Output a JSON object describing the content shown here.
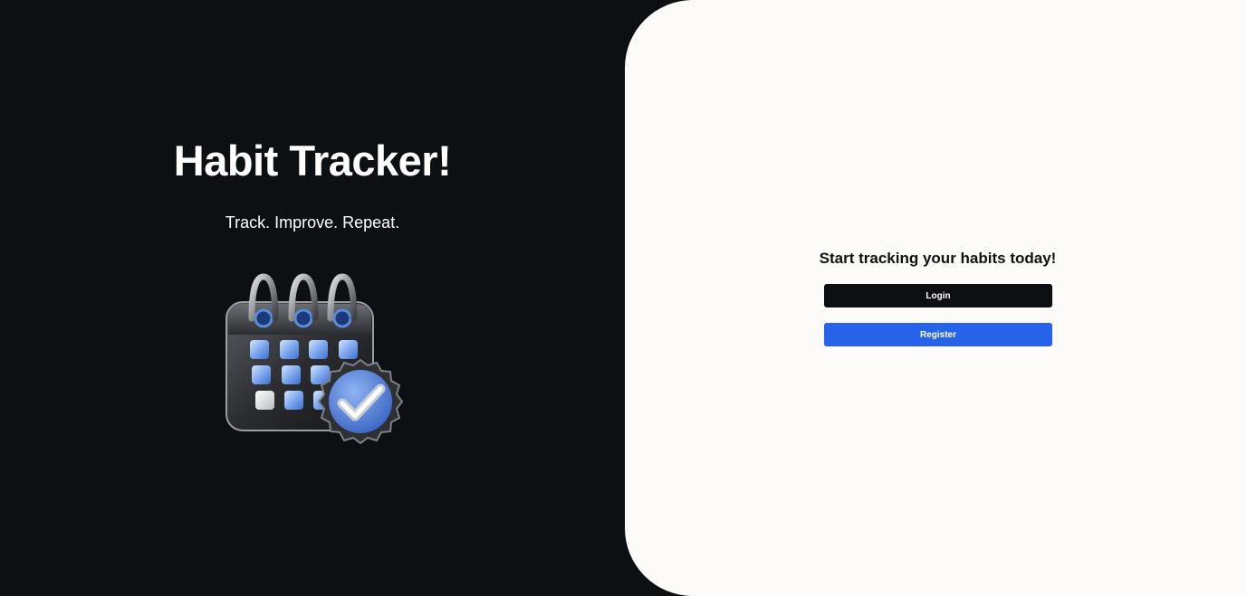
{
  "hero": {
    "title": "Habit Tracker!",
    "tagline": "Track. Improve. Repeat.",
    "illustration_icon": "calendar-check-icon"
  },
  "auth": {
    "heading": "Start tracking your habits today!",
    "login_label": "Login",
    "register_label": "Register"
  },
  "colors": {
    "dark_background": "#0d1012",
    "light_panel": "#fcfbfa",
    "login_button": "#0d1012",
    "register_button": "#2563eb",
    "accent_blue": "#5b8bdb"
  }
}
